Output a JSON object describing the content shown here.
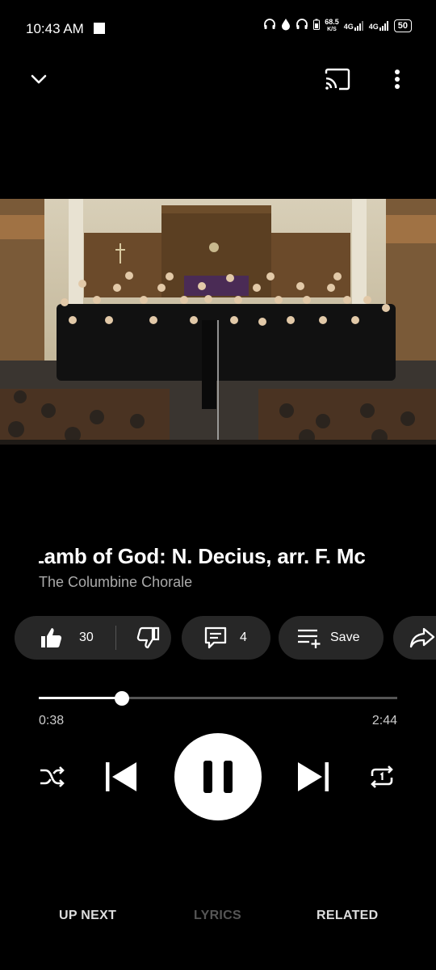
{
  "status_bar": {
    "time": "10:43 AM",
    "speed_value": "68.5",
    "speed_unit": "K/S",
    "net1": "4G",
    "net2": "4G",
    "battery": "50"
  },
  "player": {
    "title": "Lamb of God: N. Decius, arr. F. Mc",
    "artist": "The Columbine Chorale",
    "likes": "30",
    "comments": "4",
    "save_label": "Save",
    "current_time": "0:38",
    "duration": "2:44",
    "progress": 0.232
  },
  "tabs": {
    "up_next": "UP NEXT",
    "lyrics": "LYRICS",
    "related": "RELATED"
  },
  "colors": {
    "background": "#000000",
    "pill": "#272727",
    "muted_text": "#aaaaaa",
    "disabled_tab": "#555555"
  }
}
